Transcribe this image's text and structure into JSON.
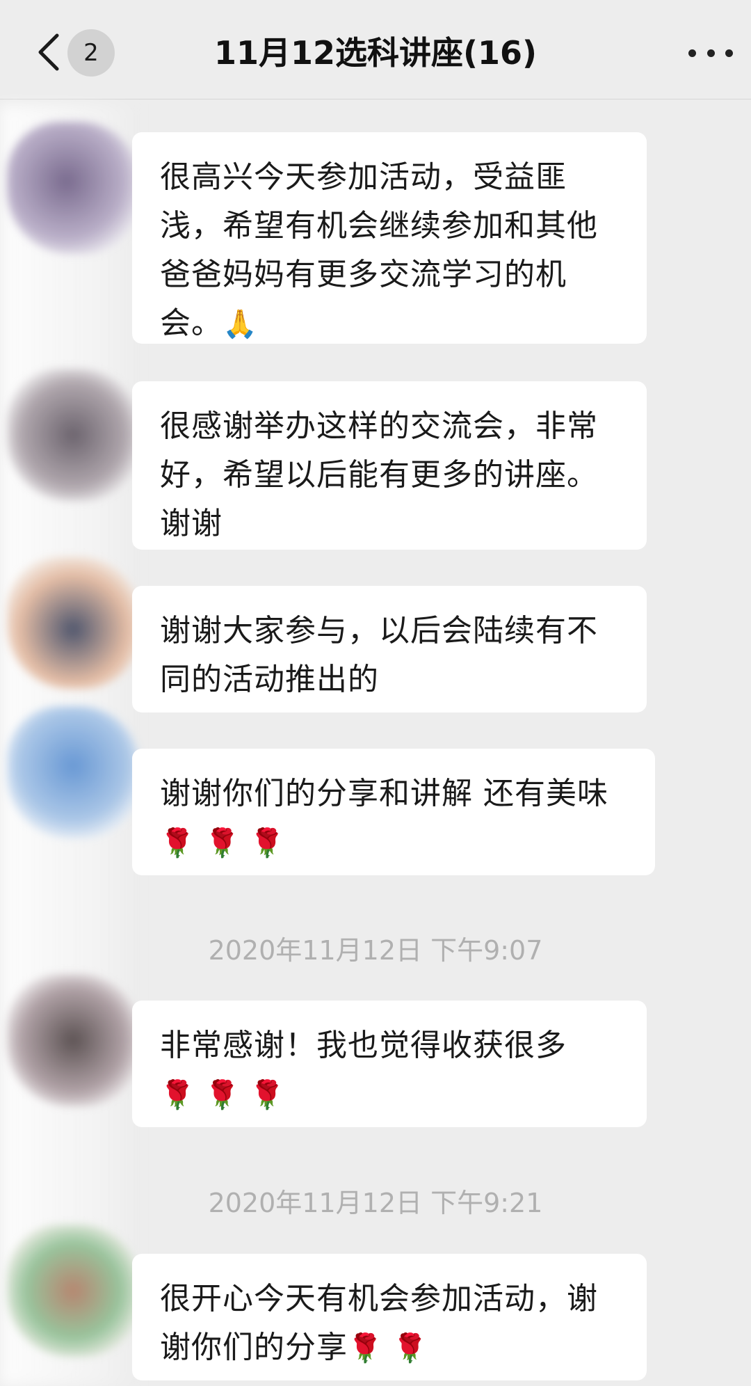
{
  "header": {
    "unread_count": "2",
    "title": "11月12选科讲座(16)",
    "icons": {
      "back": "chevron-left-icon",
      "more": "more-horizontal-icon"
    }
  },
  "messages": [
    {
      "text": "很高兴今天参加活动，受益匪浅，希望有机会继续参加和其他爸爸妈妈有更多交流学习的机会。",
      "emoji": "🙏"
    },
    {
      "text": "很感谢举办这样的交流会，非常好，希望以后能有更多的讲座。谢谢",
      "emoji": ""
    },
    {
      "text": "谢谢大家参与，以后会陆续有不同的活动推出的",
      "emoji": ""
    },
    {
      "text": "谢谢你们的分享和讲解 还有美味",
      "emoji": "🌹 🌹 🌹"
    },
    {
      "text": "非常感谢！我也觉得收获很多",
      "emoji": "🌹 🌹 🌹"
    },
    {
      "text": "很开心今天有机会参加活动，谢谢你们的分享",
      "emoji": "🌹 🌹"
    }
  ],
  "timestamps": [
    "2020年11月12日 下午9:07",
    "2020年11月12日 下午9:21"
  ],
  "colors": {
    "background": "#ededed",
    "bubble": "#ffffff",
    "timestamp_text": "#b0b0b0"
  }
}
